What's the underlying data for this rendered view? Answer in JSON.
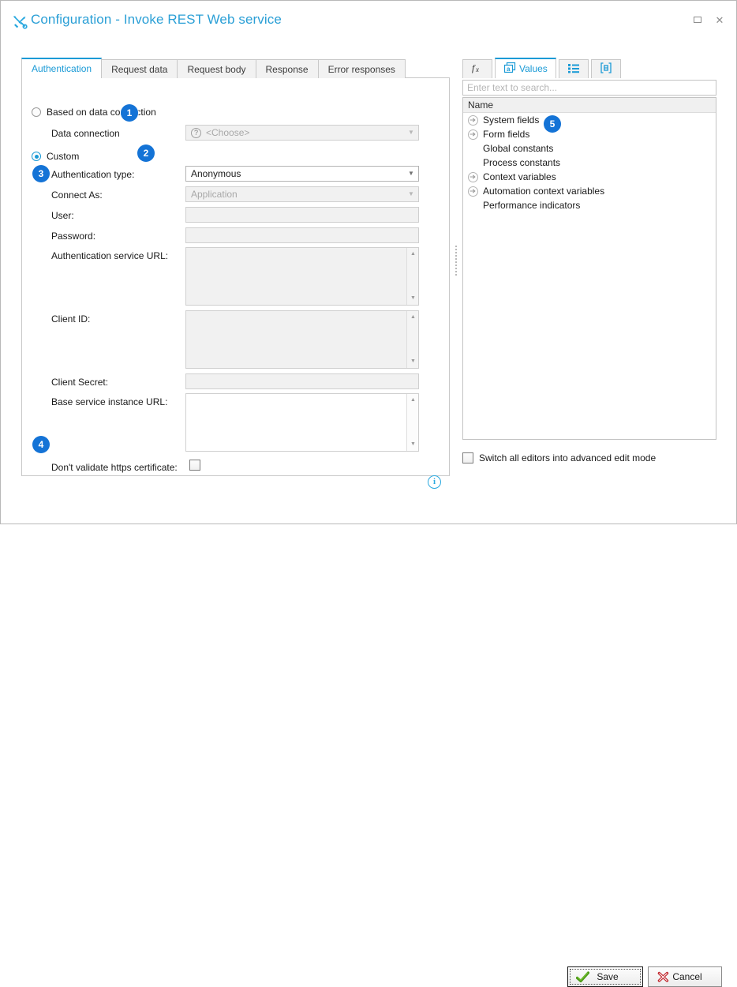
{
  "window": {
    "title": "Configuration - Invoke REST Web service",
    "title_icon": "tools-icon",
    "accent_color": "#1a9ad6",
    "badge_color": "#1473d6",
    "controls": [
      {
        "name": "maximize-button",
        "icon": "maximize-icon"
      },
      {
        "name": "close-button",
        "icon": "close-icon"
      }
    ]
  },
  "tabs": [
    {
      "label": "Authentication",
      "active": true
    },
    {
      "label": "Request data",
      "active": false
    },
    {
      "label": "Request body",
      "active": false
    },
    {
      "label": "Response",
      "active": false
    },
    {
      "label": "Error responses",
      "active": false
    }
  ],
  "form": {
    "mode_based_on_data_connection": {
      "label": "Based on data connection",
      "selected": false
    },
    "mode_custom": {
      "label": "Custom",
      "selected": true
    },
    "data_connection": {
      "label": "Data connection",
      "value": "<Choose>",
      "icon": "question-mark-icon",
      "enabled": false
    },
    "authentication_type": {
      "label": "Authentication type:",
      "value": "Anonymous",
      "enabled": true
    },
    "connect_as": {
      "label": "Connect As:",
      "value": "Application",
      "enabled": false
    },
    "user": {
      "label": "User:",
      "value": ""
    },
    "password": {
      "label": "Password:",
      "value": ""
    },
    "auth_service_url": {
      "label": "Authentication service URL:",
      "value": ""
    },
    "client_id": {
      "label": "Client ID:",
      "value": ""
    },
    "client_secret": {
      "label": "Client Secret:",
      "value": ""
    },
    "base_service_instance_url": {
      "label": "Base service instance URL:",
      "value": ""
    },
    "dont_validate_https": {
      "label": "Don't validate https certificate:",
      "checked": false
    },
    "info_glyph": "i"
  },
  "badges": [
    {
      "number": "1",
      "target": "data-connection"
    },
    {
      "number": "2",
      "target": "authentication-type"
    },
    {
      "number": "3",
      "target": "connect-as"
    },
    {
      "number": "4",
      "target": "dont-validate-https"
    },
    {
      "number": "5",
      "target": "values-tree"
    }
  ],
  "right_panel": {
    "tabs": [
      {
        "label": "",
        "icon": "function-fx-icon",
        "active": false
      },
      {
        "label": "Values",
        "icon": "values-card-icon",
        "active": true
      },
      {
        "label": "",
        "icon": "list-icon",
        "active": false
      },
      {
        "label": "",
        "icon": "bracket-icon",
        "active": false
      }
    ],
    "search": {
      "placeholder": "Enter text to search...",
      "value": ""
    },
    "tree_header": "Name",
    "tree_items": [
      {
        "label": "System fields",
        "expandable": true
      },
      {
        "label": "Form fields",
        "expandable": true
      },
      {
        "label": "Global constants",
        "expandable": false
      },
      {
        "label": "Process constants",
        "expandable": false
      },
      {
        "label": "Context variables",
        "expandable": true
      },
      {
        "label": "Automation context variables",
        "expandable": true
      },
      {
        "label": "Performance indicators",
        "expandable": false
      }
    ],
    "advanced_edit": {
      "label": "Switch all editors into advanced edit mode",
      "checked": false
    }
  },
  "footer": {
    "save_label": "Save",
    "save_icon": "green-check-icon",
    "cancel_label": "Cancel",
    "cancel_icon": "red-x-icon"
  }
}
